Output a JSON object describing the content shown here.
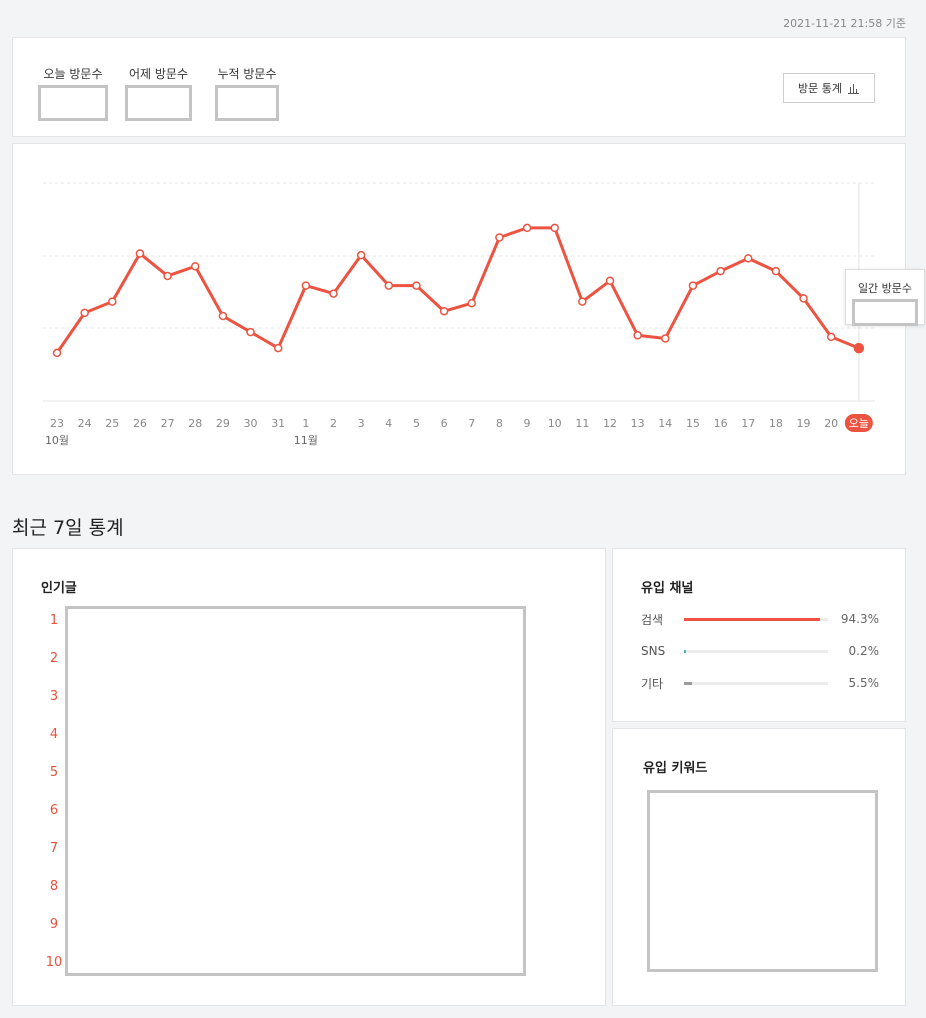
{
  "header": {
    "timestamp": "2021-11-21 21:58 기준"
  },
  "summary": {
    "today_label": "오늘 방문수",
    "yesterday_label": "어제 방문수",
    "total_label": "누적 방문수",
    "visit_stats_button": "방문 통계"
  },
  "chart_data": {
    "type": "line",
    "x": [
      "23",
      "24",
      "25",
      "26",
      "27",
      "28",
      "29",
      "30",
      "31",
      "1",
      "2",
      "3",
      "4",
      "5",
      "6",
      "7",
      "8",
      "9",
      "10",
      "11",
      "12",
      "13",
      "14",
      "15",
      "16",
      "17",
      "18",
      "19",
      "20",
      "오늘"
    ],
    "month_labels": [
      "10월",
      "11월"
    ],
    "values": [
      0.3,
      0.55,
      0.62,
      0.92,
      0.78,
      0.84,
      0.53,
      0.43,
      0.33,
      0.72,
      0.67,
      0.91,
      0.72,
      0.72,
      0.56,
      0.61,
      1.02,
      1.08,
      1.08,
      0.62,
      0.75,
      0.41,
      0.39,
      0.72,
      0.81,
      0.89,
      0.81,
      0.64,
      0.4,
      0.33
    ],
    "ylim": [
      0,
      1.36
    ],
    "grid": true,
    "series_color": "#ec5340",
    "tooltip_label": "일간 방문수"
  },
  "recent": {
    "title": "최근 7일 통계",
    "popular_title": "인기글",
    "ranks": [
      "1",
      "2",
      "3",
      "4",
      "5",
      "6",
      "7",
      "8",
      "9",
      "10"
    ],
    "channels_title": "유입 채널",
    "channels": [
      {
        "label": "검색",
        "pct_text": "94.3%",
        "value": 0.943,
        "color": "#ec5340"
      },
      {
        "label": "SNS",
        "pct_text": "0.2%",
        "value": 0.002,
        "color": "#4fb3c6"
      },
      {
        "label": "기타",
        "pct_text": "5.5%",
        "value": 0.055,
        "color": "#9b9b9b"
      }
    ],
    "keywords_title": "유입 키워드"
  },
  "icons": {
    "bar_chart": "bar-chart-icon"
  }
}
